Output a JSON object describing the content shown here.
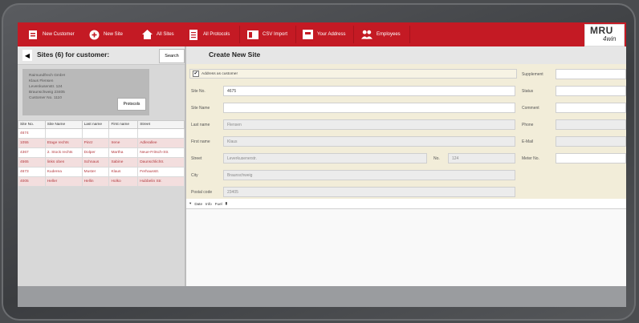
{
  "toolbar": {
    "items": [
      {
        "label": "New Customer",
        "icon": "new-customer-icon"
      },
      {
        "label": "New Site",
        "icon": "plus-circle-icon"
      },
      {
        "label": "All Sites",
        "icon": "home-icon"
      },
      {
        "label": "All Protocols",
        "icon": "document-icon"
      },
      {
        "label": "CSV Import",
        "icon": "import-icon"
      },
      {
        "label": "Your Address",
        "icon": "address-card-icon"
      },
      {
        "label": "Employees",
        "icon": "people-icon"
      }
    ],
    "accent": "#c41a24"
  },
  "logo": {
    "line1": "MRU",
    "line2": "4win"
  },
  "left": {
    "title": "Sites (6) for customer:",
    "search_label": "Search",
    "customer_lines": [
      "Raimundfrech GmbH",
      "Klaus Flensen",
      "Levenkusenstr. 124",
      "Braunschweig 23405",
      "Customer No. 1110"
    ],
    "protocols_label": "Protocols",
    "columns": [
      "Site No.",
      "Site Name",
      "Last name",
      "First name",
      "Street"
    ],
    "rows": [
      [
        "4674",
        "",
        "",
        "",
        ""
      ],
      [
        "1055",
        "Etage rechts",
        "Pinrz",
        "Irene",
        "Adlerallee"
      ],
      [
        "4367",
        "2. Stock rechts",
        "Dolper",
        "Martha",
        "Neue-Fritsch-Str."
      ],
      [
        "4565",
        "links oben",
        "Schnaus",
        "Sabine",
        "Daunschlichtr."
      ],
      [
        "4673",
        "Kuderea",
        "Muster",
        "Klaus",
        "Ferhausstr."
      ],
      [
        "4005",
        "Heller",
        "Hellin",
        "Holko",
        "Hubbelin Str."
      ]
    ]
  },
  "right": {
    "title": "Create New Site",
    "checkbox_label": "Address as customer",
    "checkbox_checked": "✔",
    "fields": {
      "site_no": {
        "label": "Site No.",
        "value": "4675"
      },
      "site_name": {
        "label": "Site Name",
        "value": ""
      },
      "last_name": {
        "label": "Last name",
        "value": "Flensen"
      },
      "first_name": {
        "label": "First name",
        "value": "Klaus"
      },
      "street": {
        "label": "Street",
        "value": "Leverkusenerstr."
      },
      "no": {
        "label": "No.",
        "value": "124"
      },
      "city": {
        "label": "City",
        "value": "Braunschweig"
      },
      "postal": {
        "label": "Postal code",
        "value": "23405"
      },
      "supplement": {
        "label": "Supplement",
        "value": ""
      },
      "status": {
        "label": "Status",
        "value": ""
      },
      "comment": {
        "label": "Comment",
        "value": ""
      },
      "phone": {
        "label": "Phone",
        "value": ""
      },
      "email": {
        "label": "E-Mail",
        "value": ""
      },
      "meter": {
        "label": "Meter No.",
        "value": ""
      }
    },
    "tabs": [
      "Date",
      "Info",
      "Fuel"
    ]
  }
}
